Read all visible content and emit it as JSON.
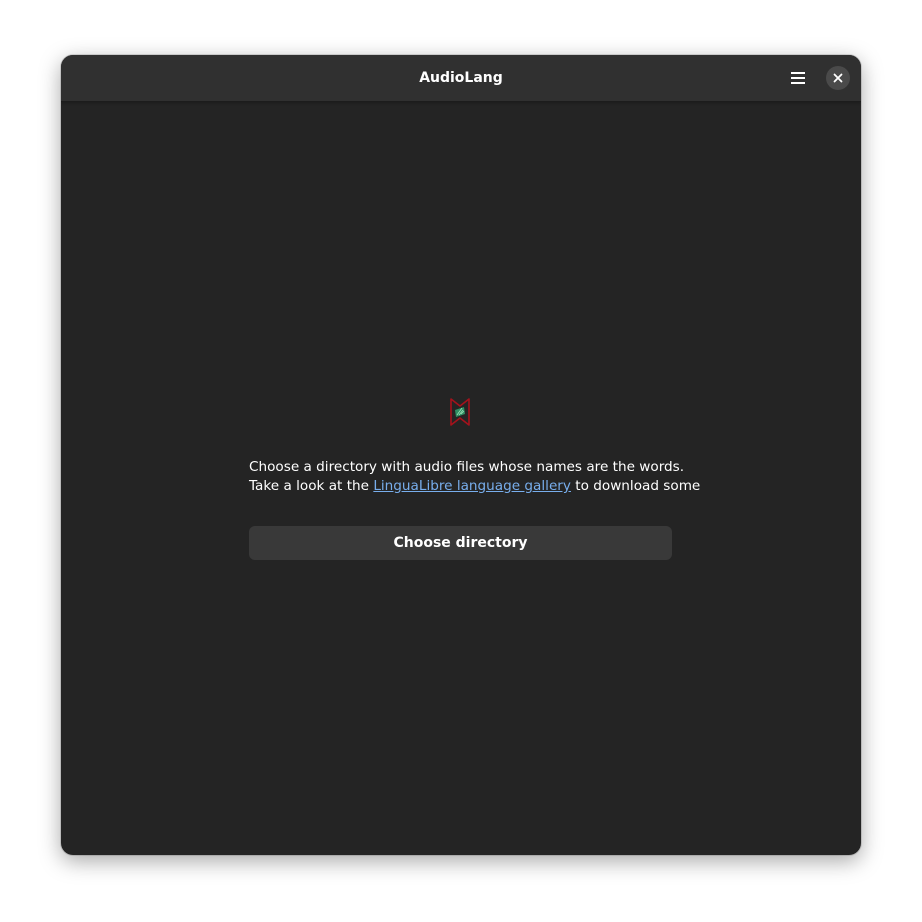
{
  "window": {
    "title": "AudioLang"
  },
  "header": {
    "menu_icon": "hamburger-menu-icon",
    "close_icon": "close-icon"
  },
  "main": {
    "app_icon": "audiolang-logo-icon",
    "line1": "Choose a directory with audio files whose names are the words.",
    "line2_prefix": "Take a look at the ",
    "link_text": "LinguaLibre language gallery",
    "line2_suffix": " to download some",
    "button_label": "Choose directory"
  },
  "colors": {
    "window_bg": "#242424",
    "headerbar_bg": "#303030",
    "button_bg": "#393939",
    "link": "#78aeed",
    "text": "#ffffff"
  }
}
